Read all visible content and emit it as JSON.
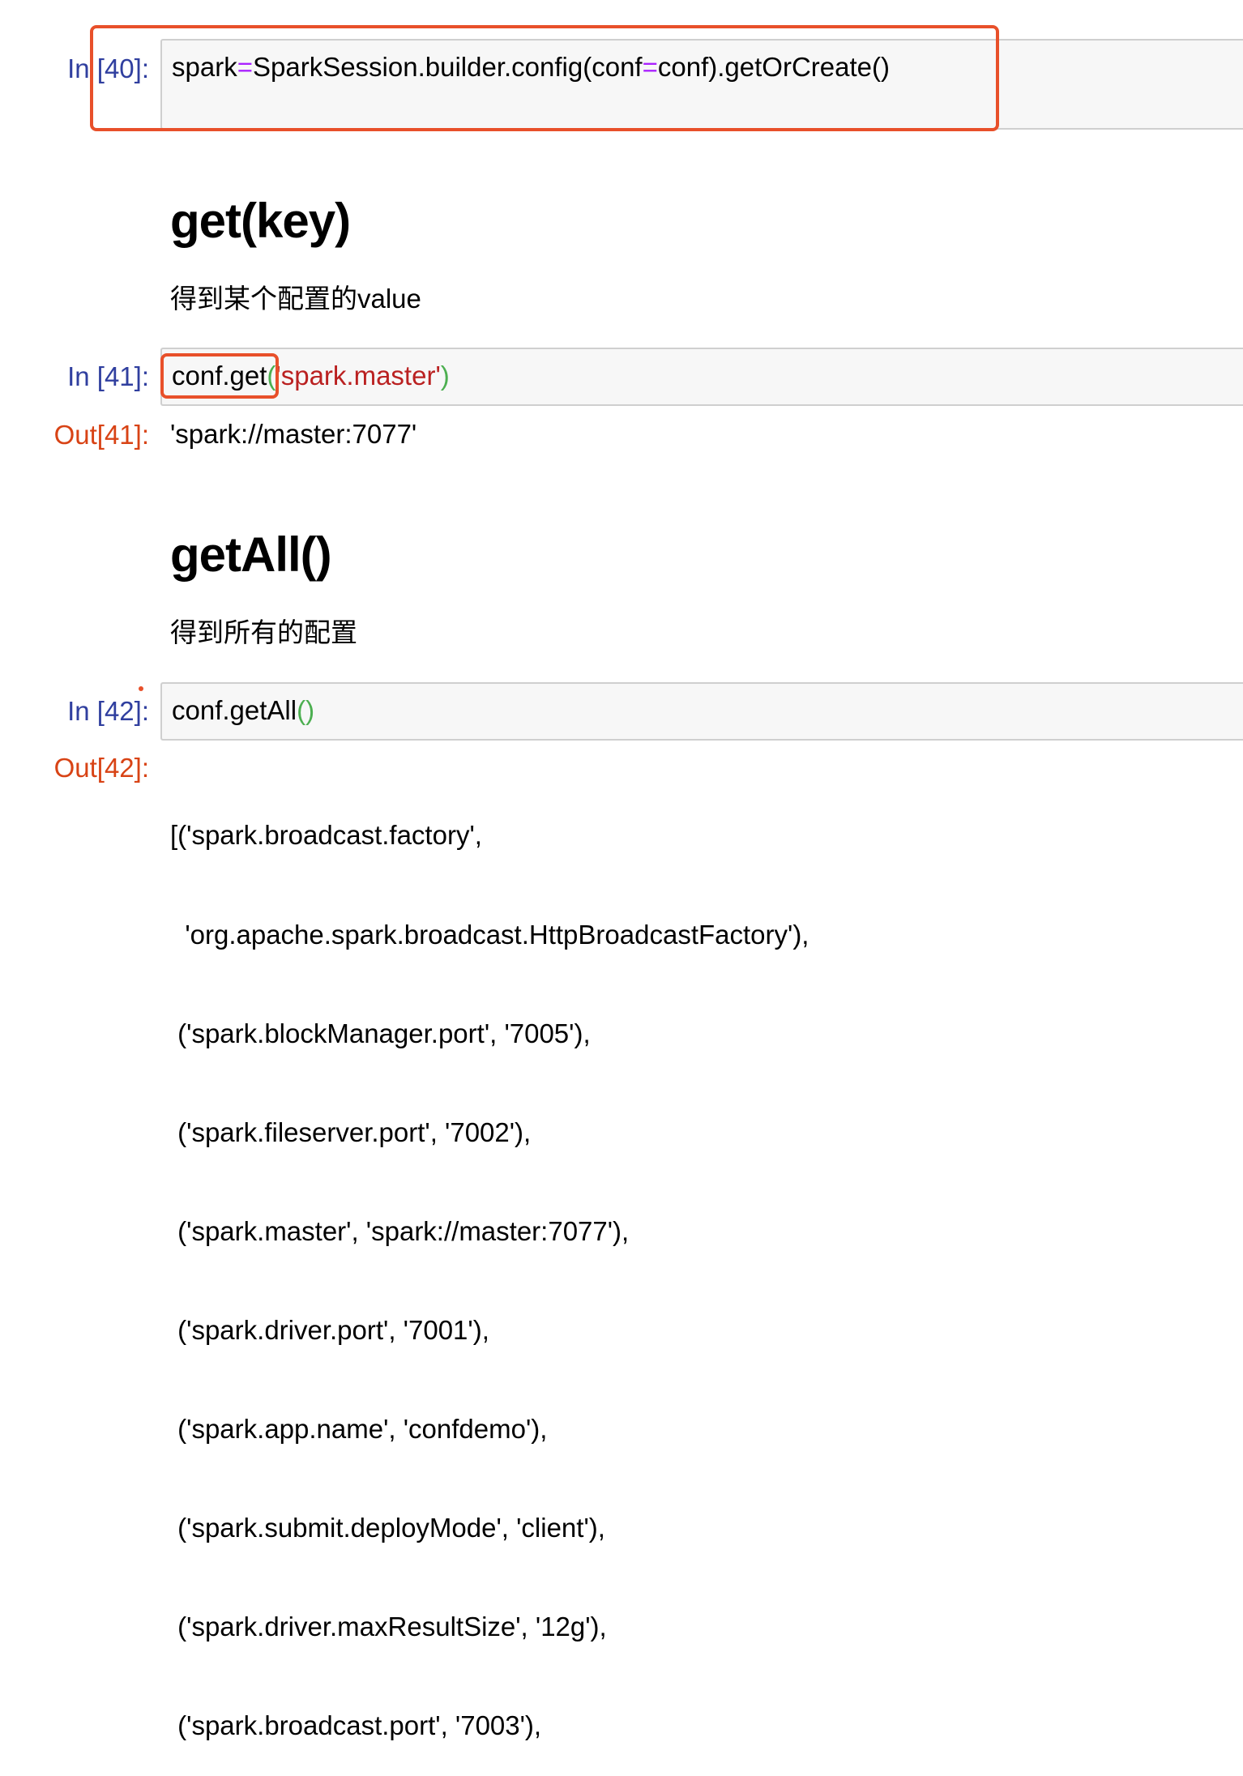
{
  "cells": {
    "c40": {
      "prompt": "In [40]:",
      "code": {
        "t1": "spark",
        "op1": "=",
        "t2": "SparkSession.builder.config(conf",
        "op2": "=",
        "t3": "conf).getOrCreate()"
      }
    },
    "md1": {
      "heading": "get(key)",
      "text": "得到某个配置的value"
    },
    "c41": {
      "prompt": "In [41]:",
      "code": {
        "t1": "conf.get",
        "p1": "(",
        "str": "'spark.master'",
        "p2": ")"
      },
      "out_prompt": "Out[41]:",
      "output": "'spark://master:7077'"
    },
    "md2": {
      "heading": "getAll()",
      "text": "得到所有的配置"
    },
    "c42": {
      "prompt": "In [42]:",
      "code": {
        "t1": "conf.getAll",
        "p": "()"
      },
      "out_prompt": "Out[42]:",
      "output_lines": [
        "[('spark.broadcast.factory',",
        "  'org.apache.spark.broadcast.HttpBroadcastFactory'),",
        " ('spark.blockManager.port', '7005'),",
        " ('spark.fileserver.port', '7002'),",
        " ('spark.master', 'spark://master:7077'),",
        " ('spark.driver.port', '7001'),",
        " ('spark.app.name', 'confdemo'),",
        " ('spark.submit.deployMode', 'client'),",
        " ('spark.driver.maxResultSize', '12g'),",
        " ('spark.broadcast.port', '7003'),"
      ]
    }
  },
  "colors": {
    "highlight": "#e8502a",
    "prompt_in": "#303f9f",
    "prompt_out": "#d84315",
    "operator": "#aa22ff",
    "string": "#ba2121",
    "bracket": "#4caf50"
  }
}
